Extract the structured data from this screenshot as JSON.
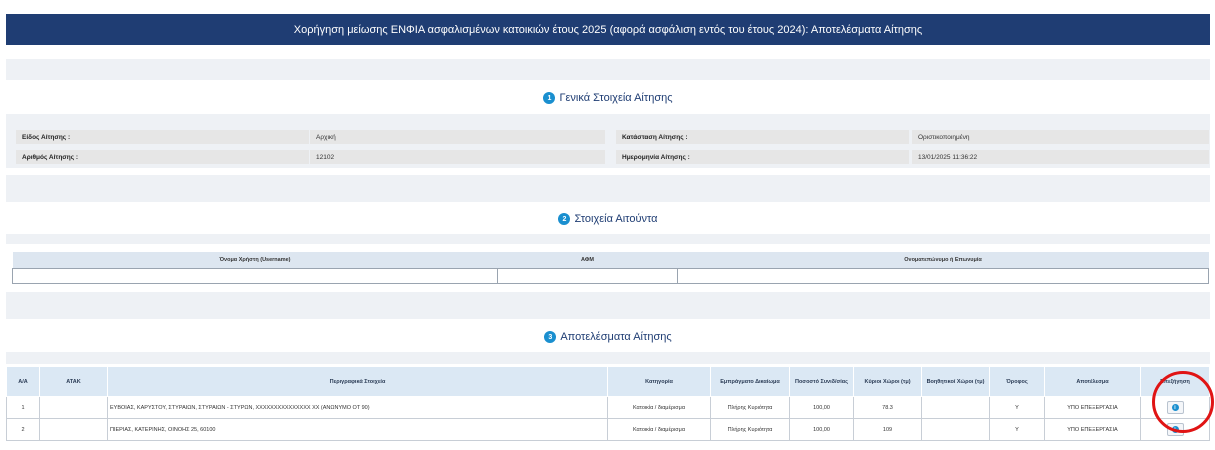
{
  "header": {
    "title": "Χορήγηση μείωσης ΕΝΦΙΑ ασφαλισμένων κατοικιών έτους 2025 (αφορά ασφάλιση εντός του έτους 2024): Αποτελέσματα Αίτησης"
  },
  "sections": [
    {
      "number": "1",
      "title": "Γενικά Στοιχεία Αίτησης"
    },
    {
      "number": "2",
      "title": "Στοιχεία Αιτούντα"
    },
    {
      "number": "3",
      "title": "Αποτελέσματα Αίτησης"
    }
  ],
  "general": {
    "type_label": "Είδος Αίτησης :",
    "type_value": "Αρχική",
    "status_label": "Κατάσταση Αίτησης :",
    "status_value": "Οριστικοποιημένη",
    "number_label": "Αριθμός Αίτησης :",
    "number_value": "12102",
    "date_label": "Ημερομηνία Αίτησης :",
    "date_value": "13/01/2025 11:36:22"
  },
  "applicant": {
    "columns": [
      "Όνομα Χρήστη (Username)",
      "ΑΦΜ",
      "Ονοματεπώνυμο ή Επωνυμία"
    ],
    "values": [
      "",
      "",
      ""
    ]
  },
  "results": {
    "columns": [
      "Α/Α",
      "ΑΤΑΚ",
      "Περιγραφικά Στοιχεία",
      "Κατηγορία",
      "Εμπράγματο Δικαίωμα",
      "Ποσοστό Συνιδ/σίας",
      "Κύριοι Χώροι (τμ)",
      "Βοηθητικοί Χώροι (τμ)",
      "Όροφος",
      "Αποτέλεσμα",
      "Επεξήγηση"
    ],
    "rows": [
      {
        "aa": "1",
        "atak": "",
        "desc": "ΕΥΒΟΙΑΣ, ΚΑΡΥΣΤΟΥ, ΣΤΥΡΑΙΩΝ, ΣΤΥΡΑΙΩΝ - ΣΤΥΡΩΝ, XXXXXXXXXXXXXXX XX (ΑΝΩΝΥΜΟ ΟΤ 90)",
        "category": "Κατοικία / διαμέρισμα",
        "right": "Πλήρης Κυριότητα",
        "percent": "100,00",
        "main": "78.3",
        "aux": "",
        "floor": "Υ",
        "result": "ΥΠΟ ΕΠΕΞΕΡΓΑΣΙΑ"
      },
      {
        "aa": "2",
        "atak": "",
        "desc": "ΠΙΕΡΙΑΣ, ΚΑΤΕΡΙΝΗΣ, ΟΙΝΟΗΣ 25, 60100",
        "category": "Κατοικία / διαμέρισμα",
        "right": "Πλήρης Κυριότητα",
        "percent": "100,00",
        "main": "109",
        "aux": "",
        "floor": "Υ",
        "result": "ΥΠΟ ΕΠΕΞΕΡΓΑΣΙΑ"
      }
    ]
  },
  "colors": {
    "header_bg": "#1f3d73",
    "accent": "#1a8fcf",
    "highlight_circle": "#e01414"
  }
}
